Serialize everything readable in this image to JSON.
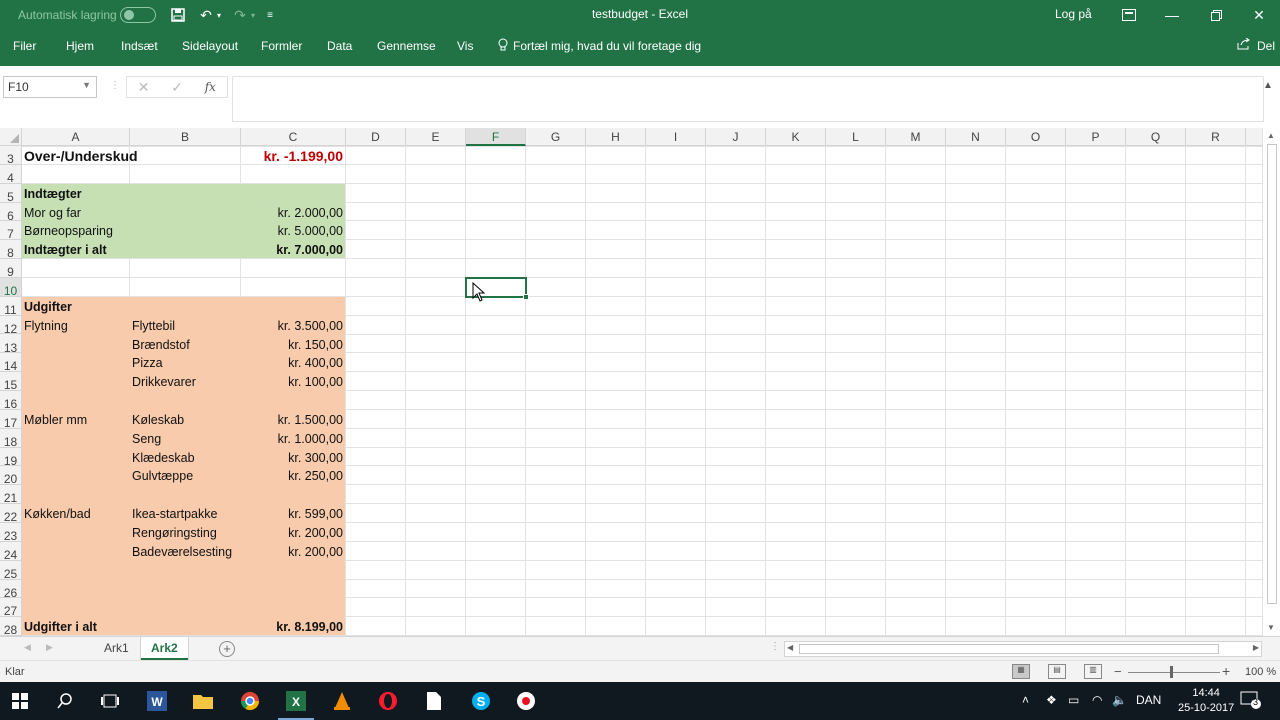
{
  "window": {
    "title": "testbudget  -  Excel",
    "autosave_label": "Automatisk lagring",
    "login": "Log på"
  },
  "ribbon": {
    "tabs": [
      "Filer",
      "Hjem",
      "Indsæt",
      "Sidelayout",
      "Formler",
      "Data",
      "Gennemse",
      "Vis"
    ],
    "tell_me": "Fortæl mig, hvad du vil foretage dig",
    "share": "Del"
  },
  "formula_bar": {
    "name_box": "F10",
    "fx": "fx",
    "value": ""
  },
  "sheet": {
    "columns": [
      "A",
      "B",
      "C",
      "D",
      "E",
      "F",
      "G",
      "H",
      "I",
      "J",
      "K",
      "L",
      "M",
      "N",
      "O",
      "P",
      "Q",
      "R"
    ],
    "selected_column": "F",
    "rows": [
      "3",
      "4",
      "5",
      "6",
      "7",
      "8",
      "9",
      "10",
      "11",
      "12",
      "13",
      "14",
      "15",
      "16",
      "17",
      "18",
      "19",
      "20",
      "21",
      "22",
      "23",
      "24",
      "25",
      "26",
      "27",
      "28"
    ],
    "selected_row": "10",
    "selected_cell": "F10",
    "cells": {
      "A3": "Over-/Underskud",
      "C3": "kr. -1.199,00",
      "A5": "Indtægter",
      "A6": "Mor og far",
      "C6": "kr. 2.000,00",
      "A7": "Børneopsparing",
      "C7": "kr. 5.000,00",
      "A8": "Indtægter i alt",
      "C8": "kr. 7.000,00",
      "A11": "Udgifter",
      "A12": "Flytning",
      "B12": "Flyttebil",
      "C12": "kr. 3.500,00",
      "B13": "Brændstof",
      "C13": "kr. 150,00",
      "B14": "Pizza",
      "C14": "kr. 400,00",
      "B15": "Drikkevarer",
      "C15": "kr. 100,00",
      "A17": "Møbler mm",
      "B17": "Køleskab",
      "C17": "kr. 1.500,00",
      "B18": "Seng",
      "C18": "kr. 1.000,00",
      "B19": "Klædeskab",
      "C19": "kr. 300,00",
      "B20": "Gulvtæppe",
      "C20": "kr. 250,00",
      "A22": "Køkken/bad",
      "B22": "Ikea-startpakke",
      "C22": "kr. 599,00",
      "B23": "Rengøringsting",
      "C23": "kr. 200,00",
      "B24": "Badeværelsesting",
      "C24": "kr. 200,00",
      "A28": "Udgifter i alt",
      "C28": "kr. 8.199,00"
    },
    "colors": {
      "income_fill": "#c6e0b4",
      "expense_fill": "#f8cbad",
      "negative_text": "#c00000",
      "accent": "#217346"
    }
  },
  "sheet_tabs": {
    "tabs": [
      "Ark1",
      "Ark2"
    ],
    "active": "Ark2"
  },
  "status_bar": {
    "status": "Klar",
    "zoom": "100 %"
  },
  "taskbar": {
    "apps": [
      "windows-start-icon",
      "search-icon",
      "task-view-icon",
      "word-icon",
      "file-explorer-icon",
      "chrome-icon",
      "excel-icon",
      "vlc-icon",
      "opera-icon",
      "file-icon",
      "skype-icon",
      "media-icon"
    ],
    "language": "DAN",
    "time": "14:44",
    "date": "25-10-2017",
    "notifications": "3"
  }
}
